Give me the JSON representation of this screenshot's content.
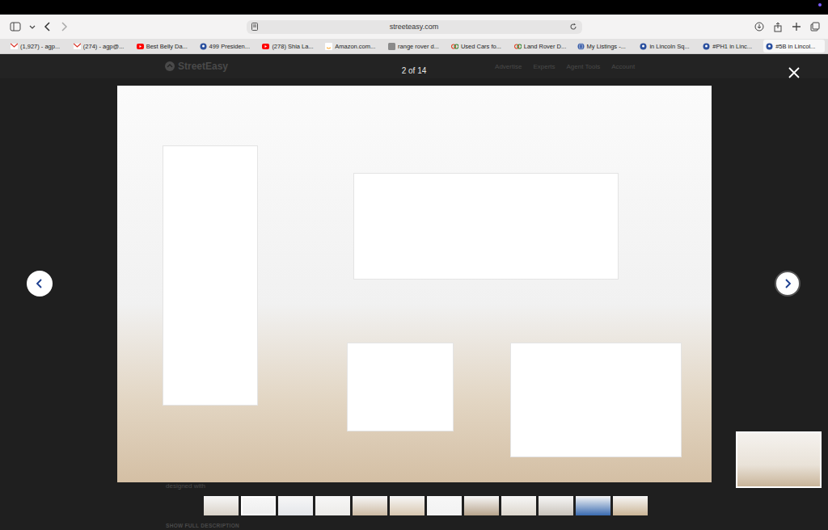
{
  "browser": {
    "address": "streeteasy.com",
    "tabs": [
      {
        "label": "(1,927) - agp...",
        "kind": "gmail",
        "selected": false
      },
      {
        "label": "(274) - agp@...",
        "kind": "gmail",
        "selected": false
      },
      {
        "label": "Best Belly Da...",
        "kind": "youtube",
        "selected": false
      },
      {
        "label": "499 Presiden...",
        "kind": "pin",
        "selected": false
      },
      {
        "label": "(278) Shia La...",
        "kind": "youtube",
        "selected": false
      },
      {
        "label": "Amazon.com...",
        "kind": "amazon",
        "selected": false
      },
      {
        "label": "range rover d...",
        "kind": "generic",
        "selected": false
      },
      {
        "label": "Used Cars fo...",
        "kind": "cg",
        "selected": false
      },
      {
        "label": "Land Rover D...",
        "kind": "cg",
        "selected": false
      },
      {
        "label": "My Listings -...",
        "kind": "globe",
        "selected": false
      },
      {
        "label": "in Lincoln Sq...",
        "kind": "pin",
        "selected": false
      },
      {
        "label": "#PH1 in Linc...",
        "kind": "pin",
        "selected": false
      },
      {
        "label": "#5B in Lincol...",
        "kind": "pin",
        "selected": true
      }
    ]
  },
  "header": {
    "logo": "StreetEasy",
    "nav": [
      "Advertise",
      "Experts",
      "Agent Tools",
      "Account"
    ]
  },
  "gallery": {
    "counter": "2 of 14",
    "thumbnails": [
      {
        "selected": false
      },
      {
        "selected": true
      },
      {
        "selected": false
      },
      {
        "selected": false
      },
      {
        "selected": false
      },
      {
        "selected": false
      },
      {
        "selected": false
      },
      {
        "selected": false
      },
      {
        "selected": false
      },
      {
        "selected": false
      },
      {
        "selected": false
      },
      {
        "selected": false
      }
    ]
  },
  "behind": {
    "description": "designed with",
    "show_more": "SHOW FULL DESCRIPTION"
  }
}
